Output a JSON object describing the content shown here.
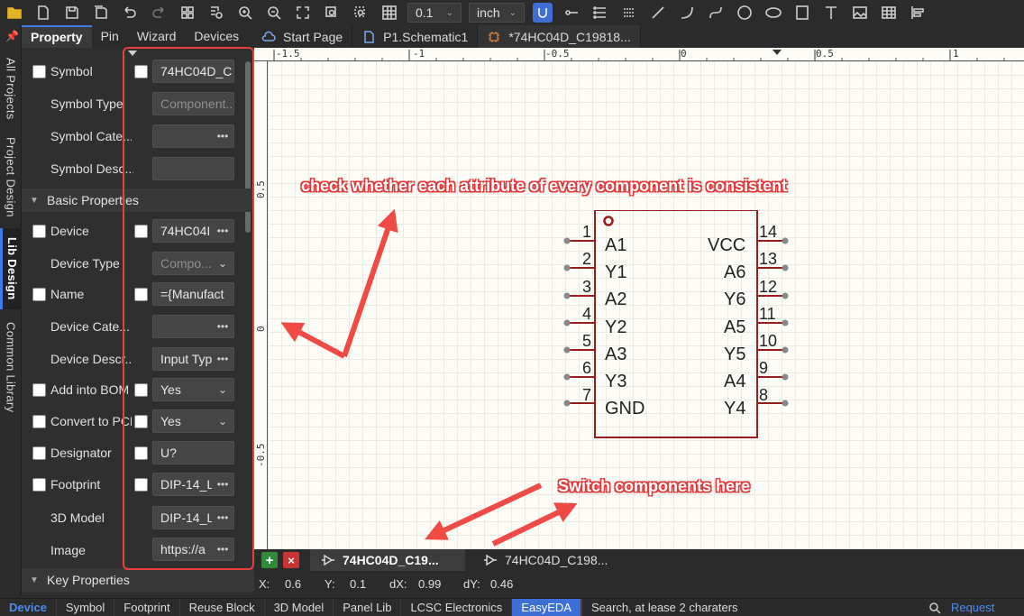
{
  "toolbar": {
    "grid_value": "0.1",
    "unit_value": "inch"
  },
  "left_strip": {
    "tabs": [
      "All Projects",
      "Project Design",
      "Lib Design",
      "Common Library"
    ]
  },
  "panel_tabs": [
    "Property",
    "Pin",
    "Wizard",
    "Devices"
  ],
  "doc_tabs": [
    "Start Page",
    "P1.Schematic1",
    "*74HC04D_C19818..."
  ],
  "properties": {
    "symbol_label": "Symbol",
    "symbol_value": "74HC04D_C",
    "symbol_type_label": "Symbol Type",
    "symbol_type_value": "Component...",
    "symbol_category_label": "Symbol Cate...",
    "symbol_desc_label": "Symbol Desc...",
    "basic_section": "Basic Properties",
    "device_label": "Device",
    "device_value": "74HC04I",
    "device_type_label": "Device Type",
    "device_type_value": "Compo...",
    "name_label": "Name",
    "name_value": "={Manufact",
    "device_category_label": "Device Cate...",
    "device_desc_label": "Device Descr...",
    "device_desc_value": "Input Typ",
    "add_bom_label": "Add into BOM",
    "add_bom_value": "Yes",
    "convert_pcb_label": "Convert to PCB",
    "convert_pcb_value": "Yes",
    "designator_label": "Designator",
    "designator_value": "U?",
    "footprint_label": "Footprint",
    "footprint_value": "DIP-14_L",
    "model3d_label": "3D Model",
    "model3d_value": "DIP-14_L",
    "image_label": "Image",
    "image_value": "https://a",
    "key_section": "Key Properties",
    "ellipsis": "•••"
  },
  "ruler": {
    "top_ticks": [
      "-1.5",
      "-1",
      "-0.5",
      "0",
      "0.5",
      "1"
    ],
    "left_ticks": [
      "0.5",
      "0",
      "-0.5"
    ]
  },
  "annotations": {
    "consistency": "check whether each attribute of every component is consistent",
    "switch": "Switch components here"
  },
  "chip": {
    "left_pins": [
      {
        "num": "1",
        "name": "A1"
      },
      {
        "num": "2",
        "name": "Y1"
      },
      {
        "num": "3",
        "name": "A2"
      },
      {
        "num": "4",
        "name": "Y2"
      },
      {
        "num": "5",
        "name": "A3"
      },
      {
        "num": "6",
        "name": "Y3"
      },
      {
        "num": "7",
        "name": "GND"
      }
    ],
    "right_pins": [
      {
        "num": "14",
        "name": "VCC"
      },
      {
        "num": "13",
        "name": "A6"
      },
      {
        "num": "12",
        "name": "Y6"
      },
      {
        "num": "11",
        "name": "A5"
      },
      {
        "num": "10",
        "name": "Y5"
      },
      {
        "num": "9",
        "name": "A4"
      },
      {
        "num": "8",
        "name": "Y4"
      }
    ]
  },
  "sheet_tabs": [
    "74HC04D_C19...",
    "74HC04D_C198..."
  ],
  "coords": {
    "x_label": "X:",
    "x_value": "0.6",
    "y_label": "Y:",
    "y_value": "0.1",
    "dx_label": "dX:",
    "dx_value": "0.99",
    "dy_label": "dY:",
    "dy_value": "0.46"
  },
  "bottom_tabs": [
    "Device",
    "Symbol",
    "Footprint",
    "Reuse Block",
    "3D Model",
    "Panel Lib",
    "LCSC Electronics",
    "EasyEDA"
  ],
  "search_placeholder": "Search, at lease 2 charaters",
  "request_link": "Request",
  "colors": {
    "accent": "#3d7be8",
    "annotation_red": "#e8413b",
    "chip_outline": "#9b1c1c"
  }
}
